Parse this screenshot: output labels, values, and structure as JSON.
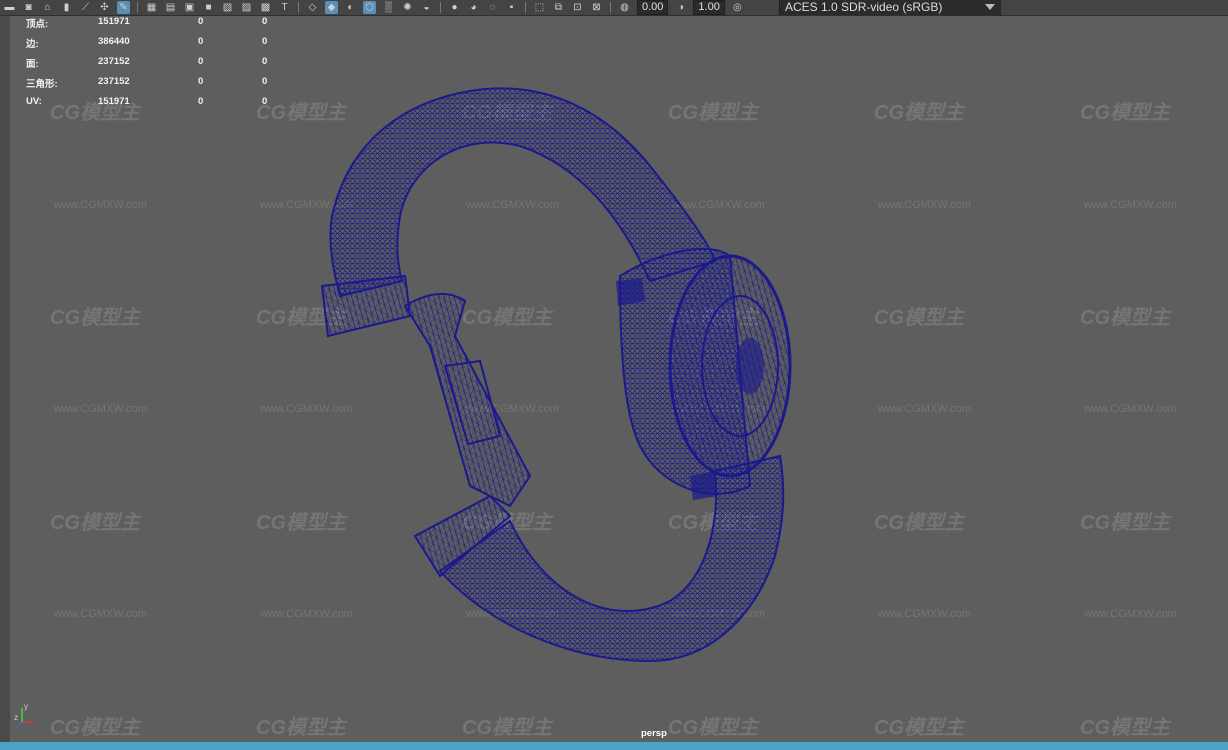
{
  "toolbar": {
    "exposure_value": "0.00",
    "gamma_value": "1.00",
    "color_space": "ACES 1.0 SDR-video (sRGB)",
    "icons": [
      "camera-icon",
      "camera-attr-icon",
      "bookmark-icon",
      "image-plane-icon",
      "grid-icon",
      "film-gate-icon",
      "resolution-gate-icon",
      "wireframe-icon",
      "smooth-shade-icon",
      "textured-icon",
      "lights-icon",
      "shadows-icon",
      "isolate-icon",
      "xray-icon",
      "gamma-icon"
    ]
  },
  "hud": {
    "rows": [
      {
        "label": "顶点:",
        "v1": "151971",
        "v2": "0",
        "v3": "0"
      },
      {
        "label": "边:",
        "v1": "386440",
        "v2": "0",
        "v3": "0"
      },
      {
        "label": "面:",
        "v1": "237152",
        "v2": "0",
        "v3": "0"
      },
      {
        "label": "三角形:",
        "v1": "237152",
        "v2": "0",
        "v3": "0"
      },
      {
        "label": "UV:",
        "v1": "151971",
        "v2": "0",
        "v3": "0"
      }
    ]
  },
  "viewport": {
    "camera_label": "persp",
    "watermark_logo": "CG模型主",
    "watermark_url": "www.CGMXW.com",
    "wire_color": "#1a1a8c",
    "background": "#5e5e5e"
  },
  "axis": {
    "y": "y",
    "z": "z"
  }
}
